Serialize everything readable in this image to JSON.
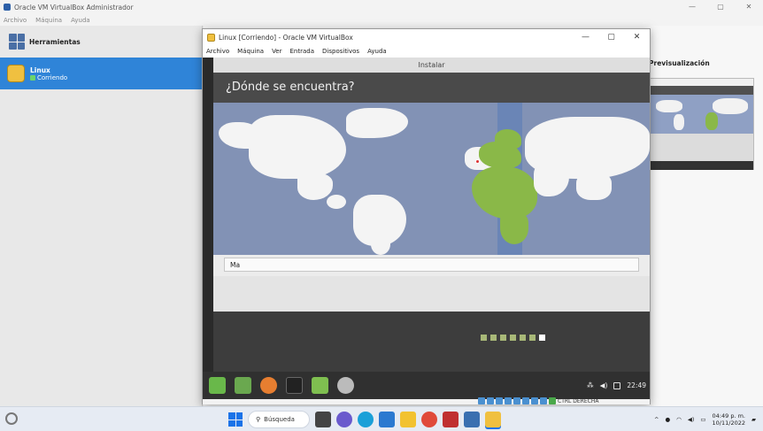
{
  "host": {
    "title": "Oracle VM VirtualBox Administrador",
    "controls": [
      "—",
      "▢",
      "✕"
    ],
    "menu": [
      "Archivo",
      "Máquina",
      "Ayuda"
    ],
    "tools_label": "Herramientas",
    "vm": {
      "name": "Linux",
      "state": "Corriendo"
    },
    "preview_label": "Previsualización",
    "accent": "#2f84d8"
  },
  "guest": {
    "title": "Linux [Corriendo] - Oracle VM VirtualBox",
    "controls": [
      "—",
      "▢",
      "✕"
    ],
    "menu": [
      "Archivo",
      "Máquina",
      "Ver",
      "Entrada",
      "Dispositivos",
      "Ayuda"
    ],
    "installer": {
      "header": "Instalar",
      "question": "¿Dónde se encuentra?",
      "search_value": "Ma",
      "progress_steps": 7,
      "progress_current": 7
    },
    "taskbar": {
      "clock": "22:49"
    },
    "status": {
      "host_key": "CTRL DERECHA"
    }
  },
  "windows_taskbar": {
    "search_label": "Búsqueda",
    "time": "04:49 p. m.",
    "date": "10/11/2022"
  }
}
